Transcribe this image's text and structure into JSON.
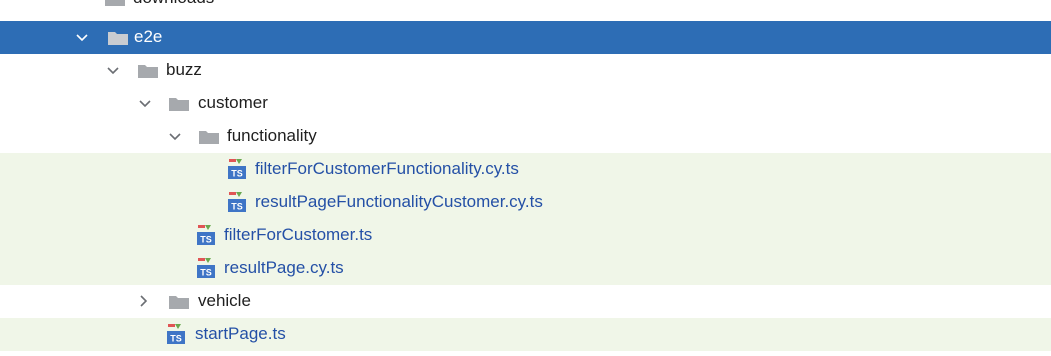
{
  "tree": {
    "rows": [
      {
        "label": "downloads",
        "kind": "folder",
        "state": "normal"
      },
      {
        "label": "e2e",
        "kind": "folder",
        "state": "selected",
        "expanded": true
      },
      {
        "label": "buzz",
        "kind": "folder",
        "state": "normal",
        "expanded": true
      },
      {
        "label": "customer",
        "kind": "folder",
        "state": "normal",
        "expanded": true
      },
      {
        "label": "functionality",
        "kind": "folder",
        "state": "normal",
        "expanded": true
      },
      {
        "label": "filterForCustomerFunctionality.cy.ts",
        "kind": "ts-file",
        "state": "changed"
      },
      {
        "label": "resultPageFunctionalityCustomer.cy.ts",
        "kind": "ts-file",
        "state": "changed"
      },
      {
        "label": "filterForCustomer.ts",
        "kind": "ts-file",
        "state": "changed"
      },
      {
        "label": "resultPage.cy.ts",
        "kind": "ts-file",
        "state": "changed"
      },
      {
        "label": "vehicle",
        "kind": "folder",
        "state": "normal",
        "expanded": false
      },
      {
        "label": "startPage.ts",
        "kind": "ts-file",
        "state": "changed"
      }
    ],
    "colors": {
      "selected_bg": "#2d6db5",
      "changed_bg": "#f0f6e8",
      "changed_text": "#2450a6",
      "folder": "#a6a9ad"
    },
    "icon_text": "TS"
  }
}
